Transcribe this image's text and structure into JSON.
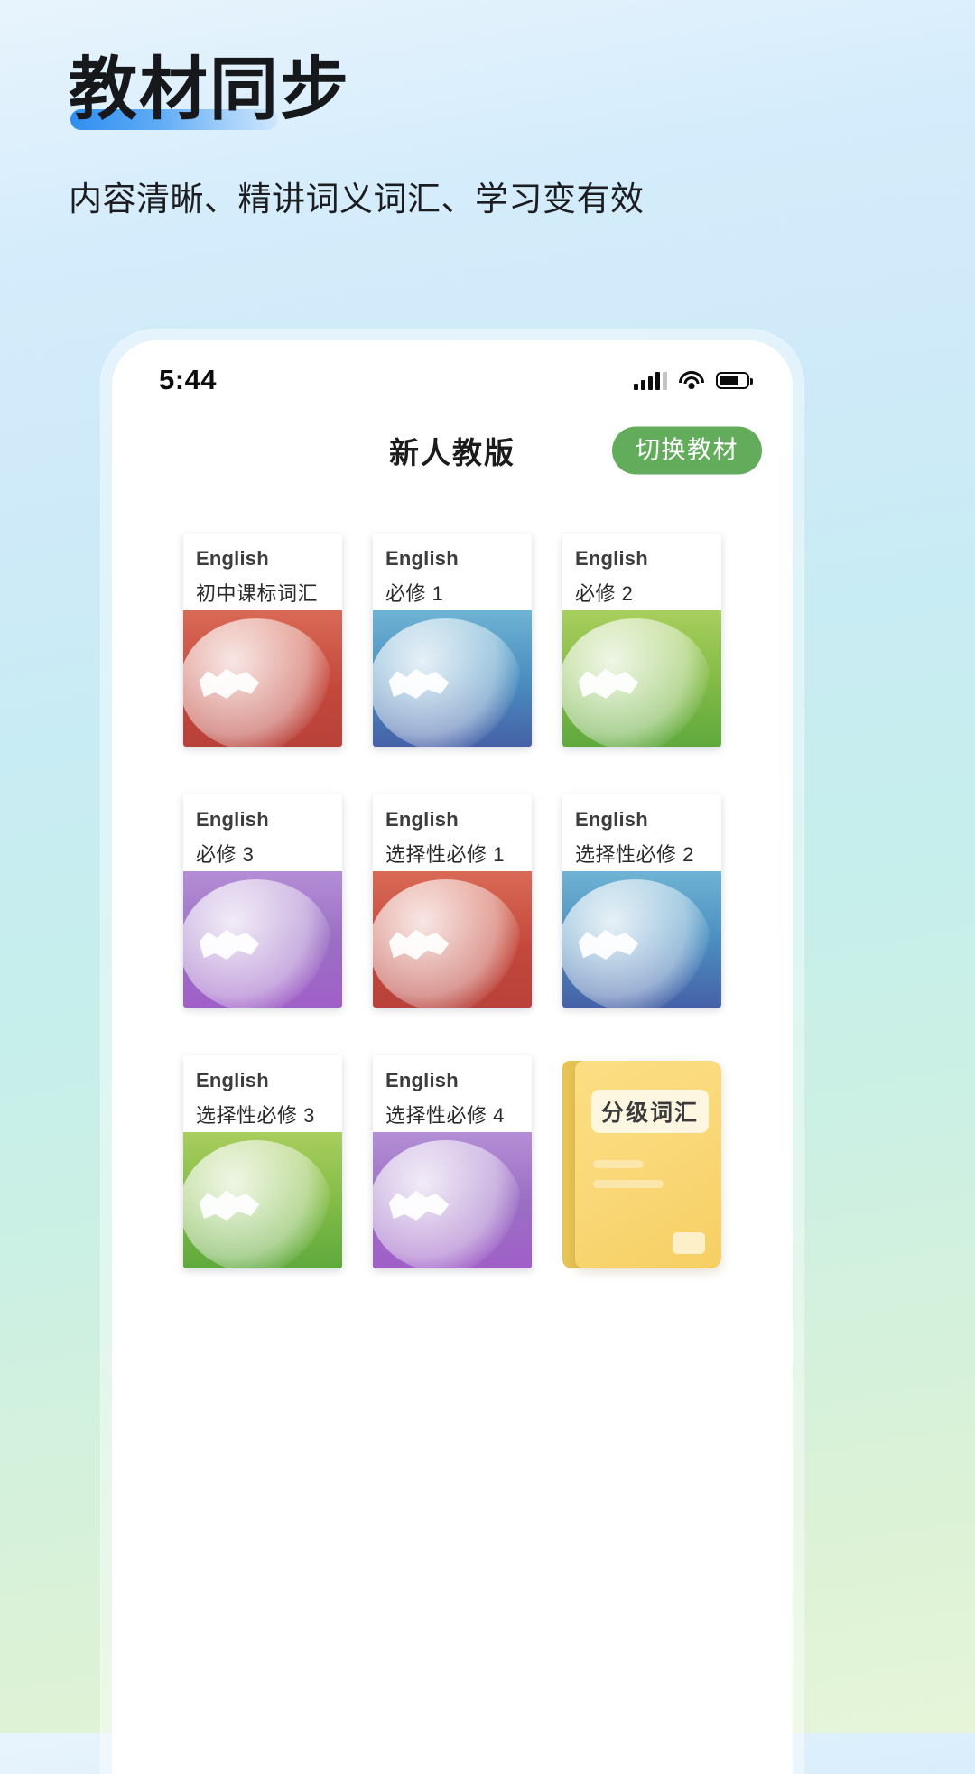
{
  "hero": {
    "title": "教材同步",
    "subtitle": "内容清晰、精讲词义词汇、学习变有效"
  },
  "phone": {
    "statusbar": {
      "time": "5:44",
      "icons": [
        "signal-icon",
        "wifi-icon",
        "battery-icon"
      ]
    },
    "app_header": {
      "title": "新人教版",
      "switch_button": "切换教材"
    },
    "books": [
      {
        "en": "English",
        "cn": "初中课标词汇",
        "color": "#c4493c",
        "theme": "red"
      },
      {
        "en": "English",
        "cn": "必修 1",
        "color": "#4a8fc0",
        "theme": "blue"
      },
      {
        "en": "English",
        "cn": "必修 2",
        "color": "#84bc46",
        "theme": "green"
      },
      {
        "en": "English",
        "cn": "必修 3",
        "color": "#9b6fc4",
        "theme": "purple"
      },
      {
        "en": "English",
        "cn": "选择性必修 1",
        "color": "#c4493c",
        "theme": "red"
      },
      {
        "en": "English",
        "cn": "选择性必修 2",
        "color": "#4a8fc0",
        "theme": "blue"
      },
      {
        "en": "English",
        "cn": "选择性必修 3",
        "color": "#84bc46",
        "theme": "green"
      },
      {
        "en": "English",
        "cn": "选择性必修 4",
        "color": "#9b6fc4",
        "theme": "purple"
      }
    ],
    "graded_card": {
      "label": "分级词汇",
      "color": "#f8d46e"
    }
  },
  "colors": {
    "accent_blue": "#2f8ef0",
    "button_green": "#63ac5c",
    "page_bg_top": "#e8f4fd",
    "page_bg_bottom": "#e6f5d8"
  }
}
